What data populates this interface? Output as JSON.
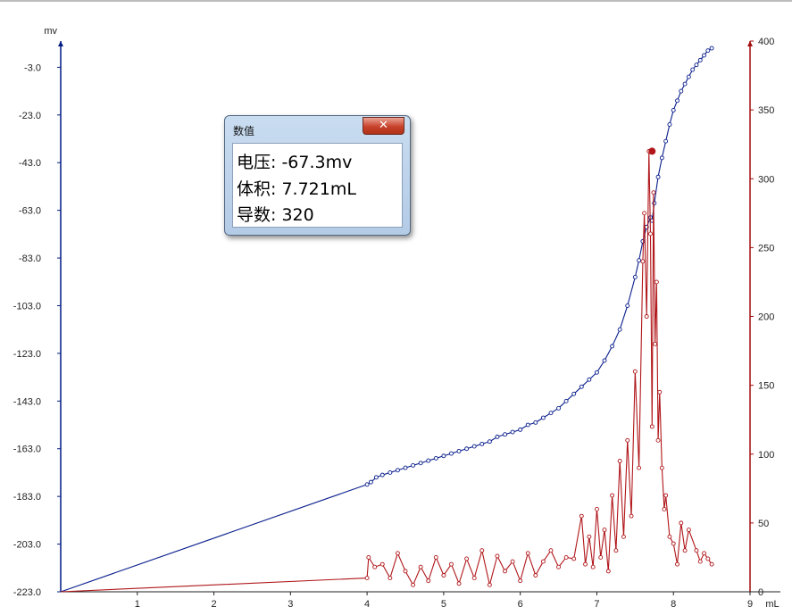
{
  "popup": {
    "title": "数值",
    "close_icon": "close-icon",
    "voltage_label": "电压: -67.3mv",
    "volume_label": "体积: 7.721mL",
    "derivative_label": "导数: 320"
  },
  "chart_data": {
    "type": "line",
    "xlabel": "mL",
    "ylabel_left": "mv",
    "x_ticks": [
      "1",
      "2",
      "3",
      "4",
      "5",
      "6",
      "7",
      "8",
      "9"
    ],
    "xlim": [
      0,
      9
    ],
    "y_left_ticks": [
      "-3.0",
      "-23.0",
      "-43.0",
      "-63.0",
      "-83.0",
      "-103.0",
      "-123.0",
      "-143.0",
      "-163.0",
      "-183.0",
      "-203.0",
      "-223.0"
    ],
    "y_left_lim": [
      -223,
      8
    ],
    "y_right_ticks": [
      "0",
      "50",
      "100",
      "150",
      "200",
      "250",
      "300",
      "350",
      "400"
    ],
    "y_right_lim": [
      0,
      400
    ],
    "colors": {
      "potential": "#0a1f8c",
      "derivative": "#b0161a",
      "axis_left": "#001a80",
      "axis_right": "#a30d0d"
    },
    "highlight": {
      "x": 7.721,
      "y_left": -67.3,
      "y_right": 320
    },
    "series": [
      {
        "axis": "left",
        "x": [
          0,
          4.0,
          4.05,
          4.12,
          4.2,
          4.3,
          4.4,
          4.5,
          4.6,
          4.7,
          4.8,
          4.9,
          5.0,
          5.1,
          5.2,
          5.3,
          5.4,
          5.5,
          5.6,
          5.7,
          5.8,
          5.9,
          6.0,
          6.1,
          6.2,
          6.3,
          6.4,
          6.5,
          6.6,
          6.7,
          6.8,
          6.9,
          7.0,
          7.1,
          7.2,
          7.3,
          7.4,
          7.5,
          7.55,
          7.6,
          7.65,
          7.7,
          7.721,
          7.75,
          7.8,
          7.85,
          7.9,
          7.95,
          8.0,
          8.05,
          8.1,
          8.15,
          8.2,
          8.25,
          8.3,
          8.35,
          8.4,
          8.45,
          8.5
        ],
        "y": [
          -223,
          -178,
          -177,
          -175,
          -174,
          -173,
          -172,
          -171,
          -170,
          -169,
          -168,
          -167,
          -166,
          -165,
          -164,
          -163,
          -162,
          -161,
          -160,
          -158,
          -157,
          -156,
          -155,
          -153,
          -152,
          -150,
          -148,
          -146,
          -143,
          -140,
          -137,
          -134,
          -131,
          -126,
          -120,
          -113,
          -103,
          -91,
          -84,
          -76,
          -70,
          -66,
          -67.3,
          -60,
          -49,
          -41,
          -34,
          -27,
          -21,
          -17,
          -13,
          -10,
          -7,
          -4,
          -2,
          0,
          2,
          4,
          5
        ]
      },
      {
        "axis": "right",
        "x": [
          0,
          4.0,
          4.02,
          4.1,
          4.2,
          4.3,
          4.4,
          4.5,
          4.6,
          4.7,
          4.8,
          4.9,
          5.0,
          5.1,
          5.2,
          5.3,
          5.4,
          5.5,
          5.6,
          5.7,
          5.8,
          5.9,
          6.0,
          6.1,
          6.2,
          6.3,
          6.4,
          6.5,
          6.6,
          6.7,
          6.8,
          6.85,
          6.9,
          6.95,
          7.0,
          7.05,
          7.1,
          7.15,
          7.2,
          7.25,
          7.3,
          7.35,
          7.4,
          7.45,
          7.5,
          7.55,
          7.6,
          7.62,
          7.65,
          7.68,
          7.7,
          7.721,
          7.74,
          7.76,
          7.78,
          7.8,
          7.82,
          7.85,
          7.88,
          7.9,
          7.95,
          8.0,
          8.05,
          8.1,
          8.15,
          8.2,
          8.3,
          8.35,
          8.4,
          8.45,
          8.5
        ],
        "y": [
          0,
          10,
          25,
          18,
          20,
          10,
          28,
          15,
          5,
          18,
          8,
          25,
          12,
          20,
          6,
          24,
          10,
          30,
          5,
          26,
          15,
          22,
          8,
          28,
          12,
          22,
          30,
          18,
          25,
          24,
          55,
          20,
          40,
          18,
          60,
          25,
          45,
          15,
          70,
          30,
          95,
          40,
          110,
          55,
          160,
          90,
          240,
          275,
          200,
          320,
          260,
          120,
          290,
          180,
          225,
          110,
          145,
          90,
          60,
          70,
          40,
          35,
          20,
          50,
          30,
          45,
          30,
          22,
          28,
          24,
          20
        ]
      }
    ]
  }
}
